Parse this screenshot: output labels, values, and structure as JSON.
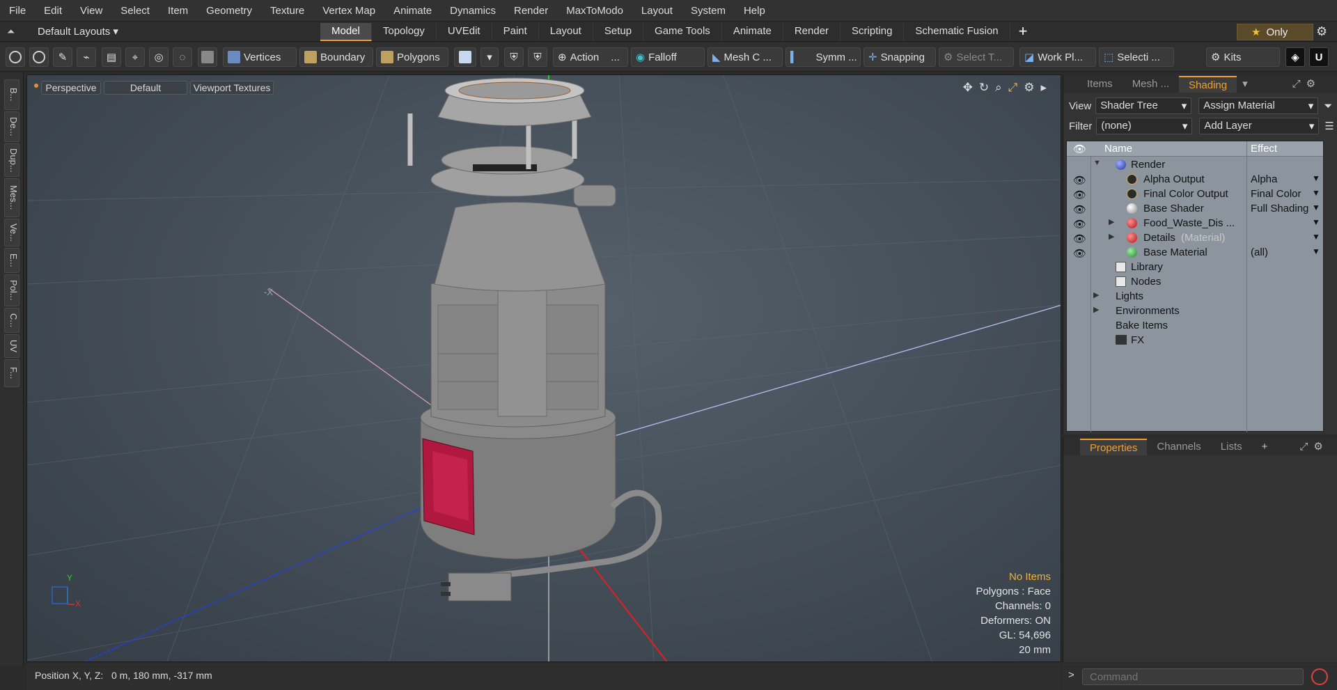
{
  "menu": [
    "File",
    "Edit",
    "View",
    "Select",
    "Item",
    "Geometry",
    "Texture",
    "Vertex Map",
    "Animate",
    "Dynamics",
    "Render",
    "MaxToModo",
    "Layout",
    "System",
    "Help"
  ],
  "layoutbar": {
    "layout_selector": "Default Layouts ▾",
    "tabs": [
      "Model",
      "Topology",
      "UVEdit",
      "Paint",
      "Layout",
      "Setup",
      "Game Tools",
      "Animate",
      "Render",
      "Scripting",
      "Schematic Fusion"
    ],
    "active_tab": "Model",
    "add_tab": "+",
    "only_label": "Only"
  },
  "toolbar": {
    "vertices": "Vertices",
    "boundary": "Boundary",
    "polygons": "Polygons",
    "action": "Action",
    "action_more": "...",
    "falloff": "Falloff",
    "mesh_c": "Mesh C ...",
    "symm": "Symm ...",
    "snapping": "Snapping",
    "select_t": "Select T...",
    "work_pl": "Work Pl...",
    "selecti": "Selecti ...",
    "kits": "Kits"
  },
  "left_strip": [
    "B...",
    "De...",
    "Dup...",
    "Mes...",
    "Ve...",
    "E...",
    "Pol...",
    "C...",
    "UV",
    "F..."
  ],
  "viewport": {
    "perspective": "Perspective",
    "default": "Default",
    "viewport_textures": "Viewport Textures",
    "hud": {
      "no_items": "No Items",
      "polygons": "Polygons : Face",
      "channels": "Channels: 0",
      "deformers": "Deformers: ON",
      "gl": "GL: 54,696",
      "scale": "20 mm"
    },
    "axis_x": "X",
    "axis_y": "Y"
  },
  "right_panel": {
    "tabs": [
      "Items",
      "Mesh ...",
      "Shading"
    ],
    "active_tab": "Shading",
    "view_label": "View",
    "view_value": "Shader Tree",
    "assign_material": "Assign Material",
    "filter_label": "Filter",
    "filter_value": "(none)",
    "add_layer": "Add Layer",
    "col_name": "Name",
    "col_effect": "Effect",
    "rows": [
      {
        "label": "Render",
        "effect": ""
      },
      {
        "label": "Alpha Output",
        "effect": "Alpha"
      },
      {
        "label": "Final Color Output",
        "effect": "Final Color"
      },
      {
        "label": "Base Shader",
        "effect": "Full Shading"
      },
      {
        "label": "Food_Waste_Dis ...",
        "effect": ""
      },
      {
        "label": "Details",
        "suffix": "(Material)",
        "effect": ""
      },
      {
        "label": "Base Material",
        "effect": "(all)"
      },
      {
        "label": "Library",
        "effect": ""
      },
      {
        "label": "Nodes",
        "effect": ""
      },
      {
        "label": "Lights",
        "effect": ""
      },
      {
        "label": "Environments",
        "effect": ""
      },
      {
        "label": "Bake Items",
        "effect": ""
      },
      {
        "label": "FX",
        "effect": ""
      }
    ]
  },
  "properties_panel": {
    "tabs": [
      "Properties",
      "Channels",
      "Lists"
    ],
    "active_tab": "Properties",
    "add": "+"
  },
  "statusbar": {
    "position": "Position X, Y, Z:   0 m, 180 mm, -317 mm"
  },
  "command": {
    "prompt": ">",
    "placeholder": "Command"
  },
  "colors": {
    "accent": "#f0a030",
    "viewport_bg": "#4a545e",
    "tree_bg": "#8c959e",
    "label_red": "#d0204a"
  }
}
